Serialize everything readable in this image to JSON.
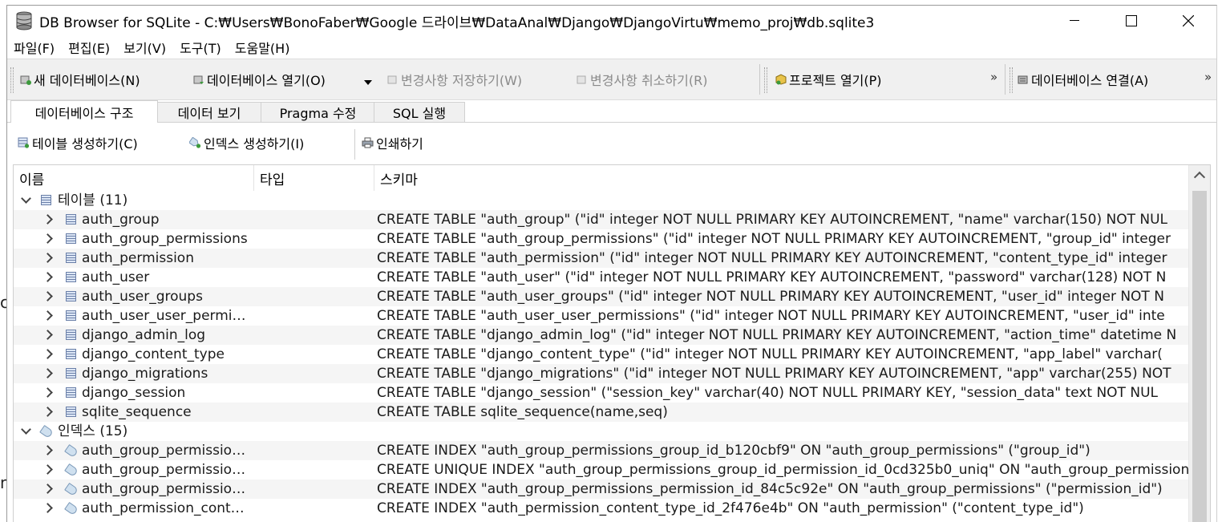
{
  "window": {
    "title": "DB Browser for SQLite - C:₩Users₩BonoFaber₩Google 드라이브₩DataAnal₩Django₩DjangoVirtu₩memo_proj₩db.sqlite3",
    "minimize": "—",
    "maximize": "☐",
    "close": "✕"
  },
  "menu": [
    "파일(F)",
    "편집(E)",
    "보기(V)",
    "도구(T)",
    "도움말(H)"
  ],
  "toolbar": {
    "new_db": "새 데이터베이스(N)",
    "open_db": "데이터베이스 열기(O)",
    "write_changes": "변경사항 저장하기(W)",
    "revert_changes": "변경사항 취소하기(R)",
    "open_project": "프로젝트 열기(P)",
    "attach_db": "데이터베이스 연결(A)",
    "more": "»"
  },
  "tabs": [
    "데이터베이스 구조",
    "데이터 보기",
    "Pragma 수정",
    "SQL 실행"
  ],
  "structure_toolbar": {
    "create_table": "테이블 생성하기(C)",
    "create_index": "인덱스 생성하기(I)",
    "print": "인쇄하기"
  },
  "columns": {
    "name": "이름",
    "type": "타입",
    "schema": "스키마"
  },
  "groups": {
    "tables": "테이블 (11)",
    "indices": "인덱스 (15)"
  },
  "tables": [
    {
      "name": "auth_group",
      "schema": "CREATE TABLE \"auth_group\" (\"id\" integer NOT NULL PRIMARY KEY AUTOINCREMENT, \"name\" varchar(150) NOT NUL"
    },
    {
      "name": "auth_group_permissions",
      "schema": "CREATE TABLE \"auth_group_permissions\" (\"id\" integer NOT NULL PRIMARY KEY AUTOINCREMENT, \"group_id\" integer"
    },
    {
      "name": "auth_permission",
      "schema": "CREATE TABLE \"auth_permission\" (\"id\" integer NOT NULL PRIMARY KEY AUTOINCREMENT, \"content_type_id\" integer"
    },
    {
      "name": "auth_user",
      "schema": "CREATE TABLE \"auth_user\" (\"id\" integer NOT NULL PRIMARY KEY AUTOINCREMENT, \"password\" varchar(128) NOT N"
    },
    {
      "name": "auth_user_groups",
      "schema": "CREATE TABLE \"auth_user_groups\" (\"id\" integer NOT NULL PRIMARY KEY AUTOINCREMENT, \"user_id\" integer NOT N"
    },
    {
      "name": "auth_user_user_permi…",
      "schema": "CREATE TABLE \"auth_user_user_permissions\" (\"id\" integer NOT NULL PRIMARY KEY AUTOINCREMENT, \"user_id\" inte"
    },
    {
      "name": "django_admin_log",
      "schema": "CREATE TABLE \"django_admin_log\" (\"id\" integer NOT NULL PRIMARY KEY AUTOINCREMENT, \"action_time\" datetime N"
    },
    {
      "name": "django_content_type",
      "schema": "CREATE TABLE \"django_content_type\" (\"id\" integer NOT NULL PRIMARY KEY AUTOINCREMENT, \"app_label\" varchar("
    },
    {
      "name": "django_migrations",
      "schema": "CREATE TABLE \"django_migrations\" (\"id\" integer NOT NULL PRIMARY KEY AUTOINCREMENT, \"app\" varchar(255) NOT"
    },
    {
      "name": "django_session",
      "schema": "CREATE TABLE \"django_session\" (\"session_key\" varchar(40) NOT NULL PRIMARY KEY, \"session_data\" text NOT NUL"
    },
    {
      "name": "sqlite_sequence",
      "schema": "CREATE TABLE sqlite_sequence(name,seq)"
    }
  ],
  "indices": [
    {
      "name": "auth_group_permissio…",
      "schema": "CREATE INDEX \"auth_group_permissions_group_id_b120cbf9\" ON \"auth_group_permissions\" (\"group_id\")"
    },
    {
      "name": "auth_group_permissio…",
      "schema": "CREATE UNIQUE INDEX \"auth_group_permissions_group_id_permission_id_0cd325b0_uniq\" ON \"auth_group_permission"
    },
    {
      "name": "auth_group_permissio…",
      "schema": "CREATE INDEX \"auth_group_permissions_permission_id_84c5c92e\" ON \"auth_group_permissions\" (\"permission_id\")"
    },
    {
      "name": "auth_permission_cont…",
      "schema": "CREATE INDEX \"auth_permission_content_type_id_2f476e4b\" ON \"auth_permission\" (\"content_type_id\")"
    }
  ],
  "colors": {
    "toolbar_bg": "#f0f0f0",
    "alt_row": "#f5f5f5",
    "disabled_text": "#8a8a8a"
  }
}
